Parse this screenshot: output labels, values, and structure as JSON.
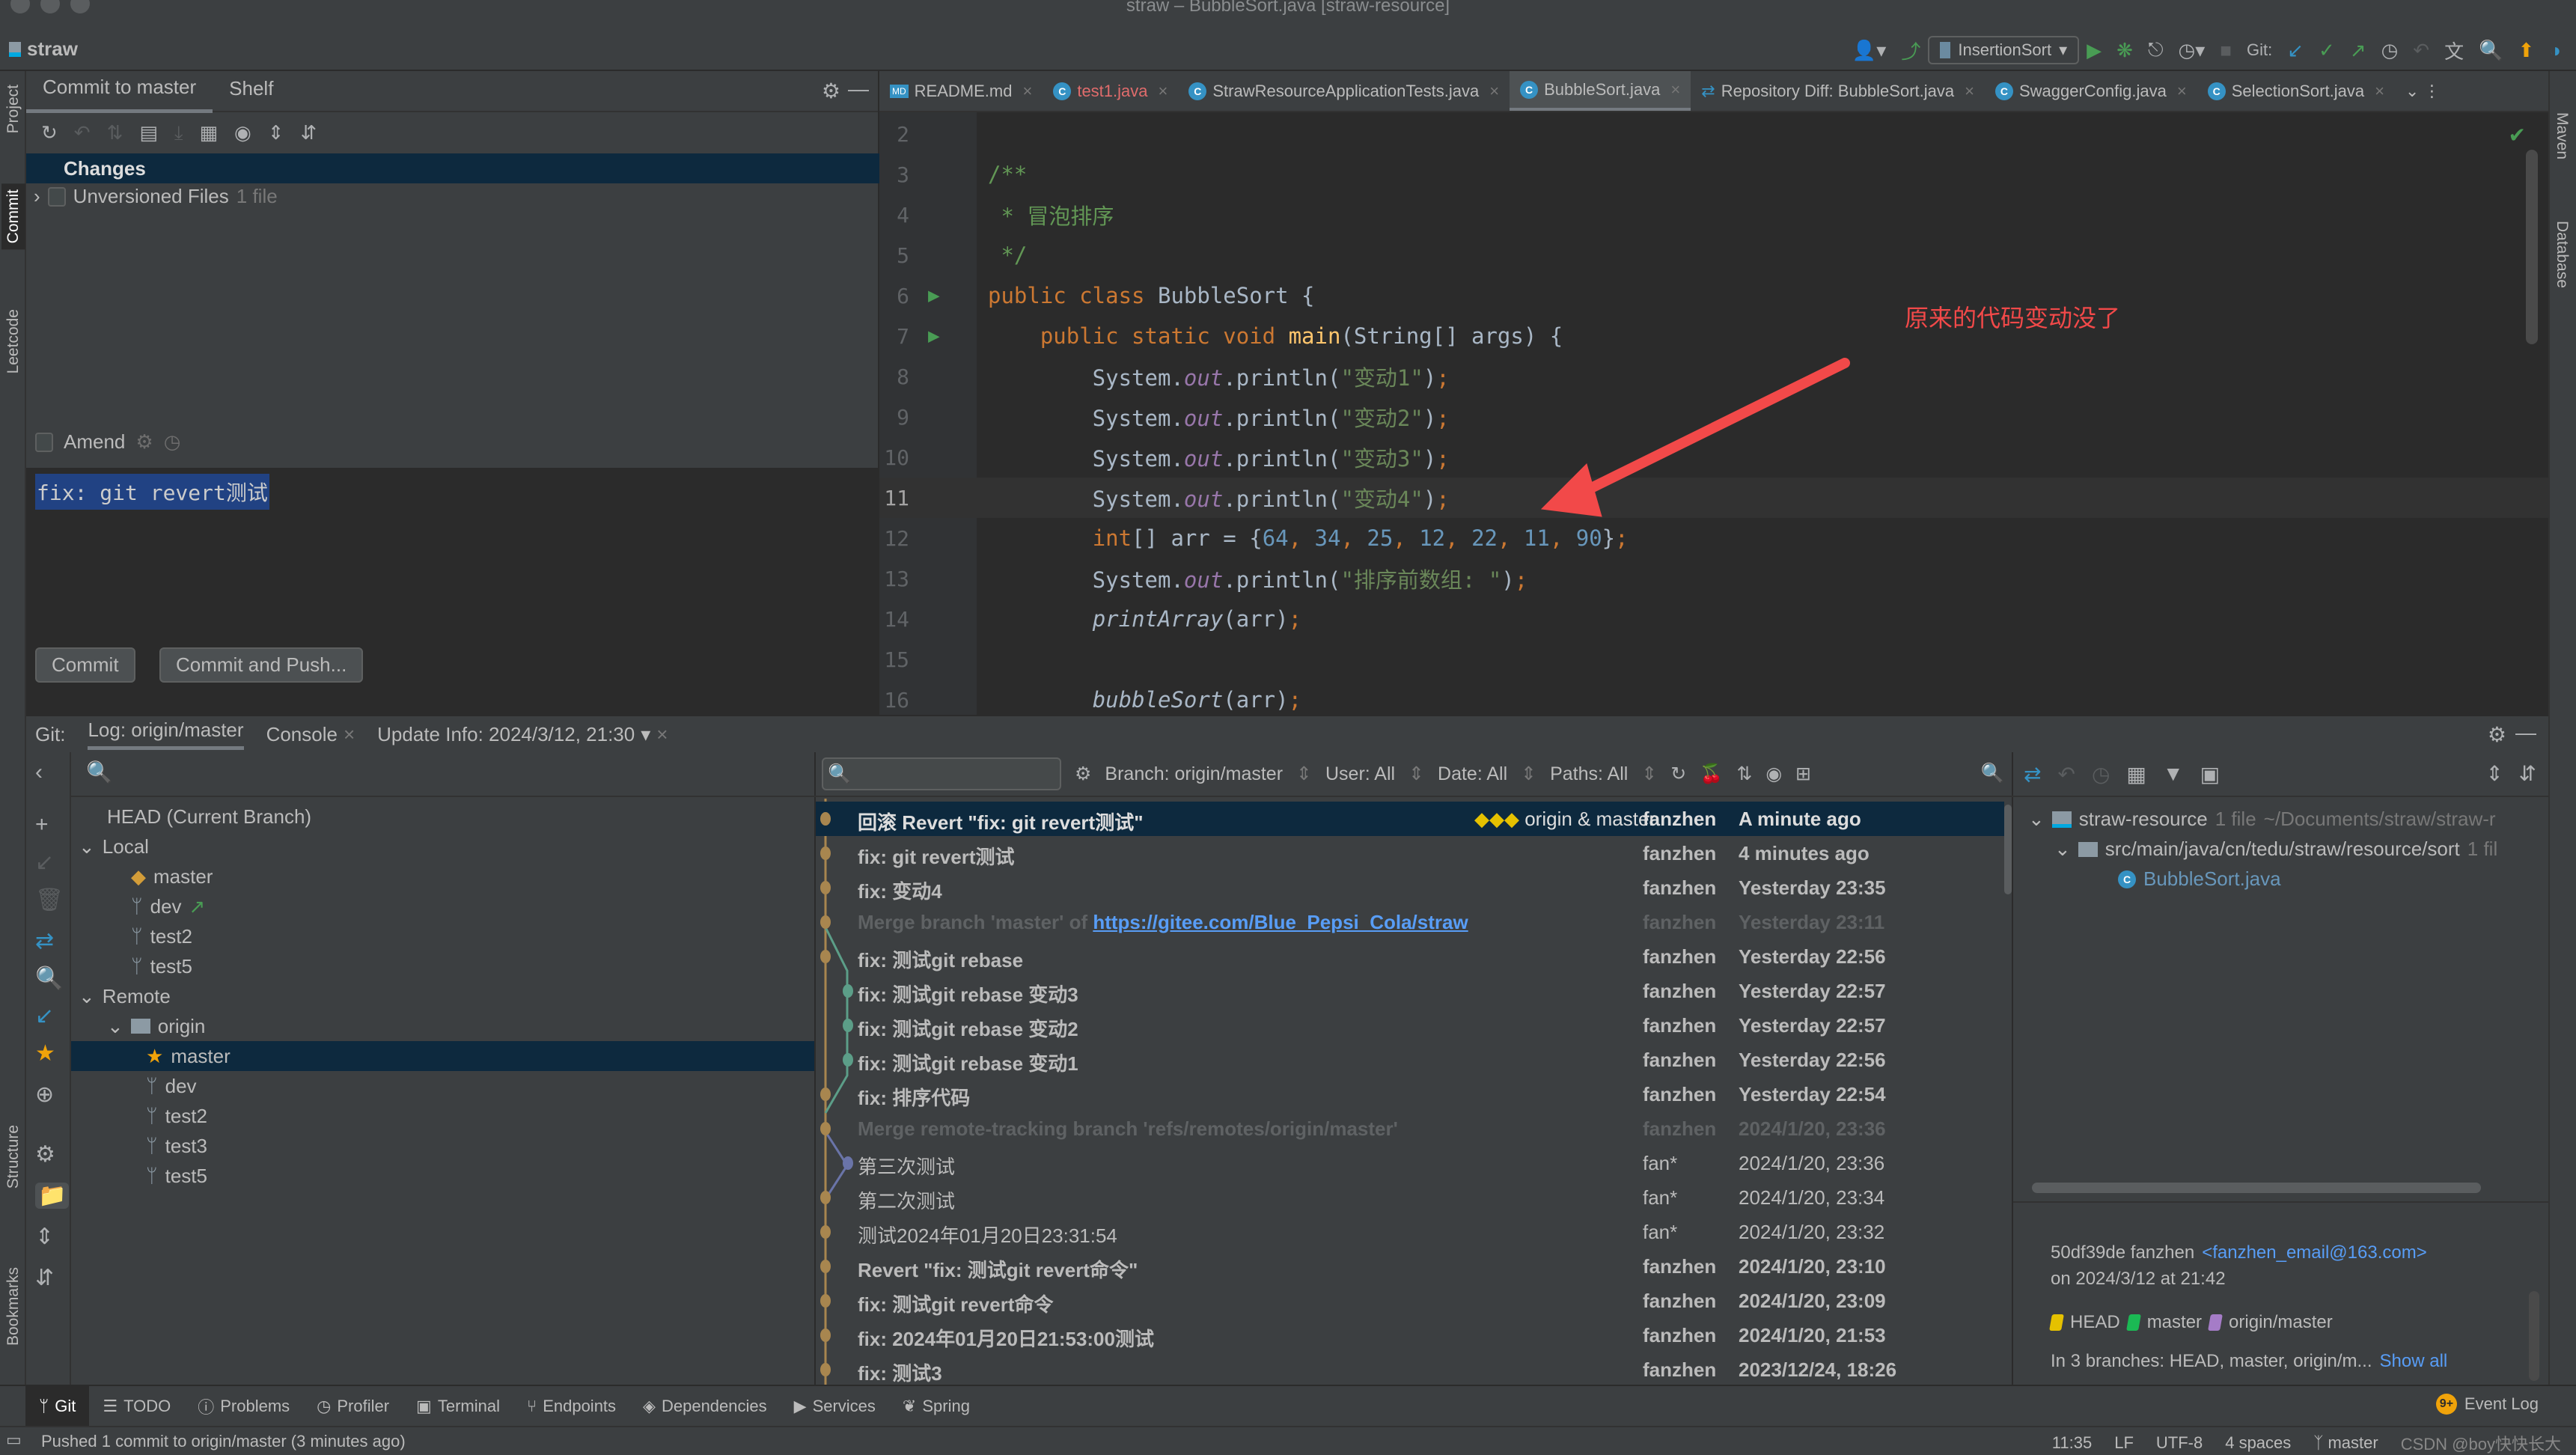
{
  "window": {
    "title": "straw – BubbleSort.java [straw-resource]",
    "project": "straw"
  },
  "toolbar": {
    "run_config": "InsertionSort",
    "git_label": "Git:",
    "icons": [
      "user-icon",
      "build-hammer-icon",
      "run-icon",
      "debug-icon",
      "coverage-icon",
      "profile-icon",
      "stop-icon",
      "git-update-icon",
      "git-commit-icon",
      "git-push-icon",
      "history-icon",
      "rollback-icon",
      "translate-icon",
      "search-icon",
      "update-icon",
      "plugin-icon"
    ]
  },
  "left_strip": {
    "tabs": [
      "Project",
      "Commit",
      "Leetcode",
      "Structure",
      "Bookmarks"
    ]
  },
  "right_strip": {
    "tabs": [
      "Maven",
      "Database"
    ]
  },
  "commit_panel": {
    "tabs": [
      "Commit to master",
      "Shelf"
    ],
    "changes_label": "Changes",
    "unversioned_label": "Unversioned Files",
    "unversioned_count": "1 file",
    "amend_label": "Amend",
    "message": "fix: git revert测试",
    "commit_button": "Commit",
    "commit_push_button": "Commit and Push..."
  },
  "editor": {
    "tabs": [
      {
        "label": "README.md",
        "type": "md"
      },
      {
        "label": "test1.java",
        "type": "java",
        "modified": true
      },
      {
        "label": "StrawResourceApplicationTests.java",
        "type": "java"
      },
      {
        "label": "BubbleSort.java",
        "type": "java",
        "active": true
      },
      {
        "label": "Repository Diff: BubbleSort.java",
        "type": "diff"
      },
      {
        "label": "SwaggerConfig.java",
        "type": "java"
      },
      {
        "label": "SelectionSort.java",
        "type": "java"
      }
    ],
    "current_line": 11,
    "lines": [
      {
        "n": "2",
        "html": ""
      },
      {
        "n": "3",
        "html": "<span class='cmt'>/**</span>"
      },
      {
        "n": "4",
        "html": "<span class='cmt'> * 冒泡排序</span>"
      },
      {
        "n": "5",
        "html": "<span class='cmt'> */</span>"
      },
      {
        "n": "6",
        "html": "<span class='kw'>public class </span>BubbleSort {",
        "run": true
      },
      {
        "n": "7",
        "html": "    <span class='kw'>public static void </span><span class='fn'>main</span>(String[] args) {",
        "run": true
      },
      {
        "n": "8",
        "html": "        System.<span class='fld'>out</span>.println(<span class='str'>\"变动1\"</span>)<span class='kw'>;</span>"
      },
      {
        "n": "9",
        "html": "        System.<span class='fld'>out</span>.println(<span class='str'>\"变动2\"</span>)<span class='kw'>;</span>"
      },
      {
        "n": "10",
        "html": "        System.<span class='fld'>out</span>.println(<span class='str'>\"变动3\"</span>)<span class='kw'>;</span>"
      },
      {
        "n": "11",
        "html": "        System.<span class='fld'>out</span>.println(<span class='str'>\"变动4\"</span>)<span class='kw'>;</span>"
      },
      {
        "n": "12",
        "html": "        <span class='kw'>int</span>[] arr = {<span class='num'>64</span><span class='kw'>, </span><span class='num'>34</span><span class='kw'>, </span><span class='num'>25</span><span class='kw'>, </span><span class='num'>12</span><span class='kw'>, </span><span class='num'>22</span><span class='kw'>, </span><span class='num'>11</span><span class='kw'>, </span><span class='num'>90</span>}<span class='kw'>;</span>"
      },
      {
        "n": "13",
        "html": "        System.<span class='fld'>out</span>.println(<span class='str'>\"排序前数组: \"</span>)<span class='kw'>;</span>"
      },
      {
        "n": "14",
        "html": "        <span class='it'>printArray</span>(arr)<span class='kw'>;</span>"
      },
      {
        "n": "15",
        "html": ""
      },
      {
        "n": "16",
        "html": "        <span class='it'>bubbleSort</span>(arr)<span class='kw'>;</span>"
      }
    ],
    "annotation": "原来的代码变动没了"
  },
  "git_panel": {
    "label": "Git:",
    "tabs": [
      {
        "label": "Log: origin/master",
        "active": true
      },
      {
        "label": "Console",
        "closable": true
      },
      {
        "label": "Update Info: 2024/3/12, 21:30",
        "closable": true,
        "dropdown": true
      }
    ],
    "branches": {
      "head": "HEAD (Current Branch)",
      "local_label": "Local",
      "local": [
        {
          "name": "master",
          "icon": "tag",
          "current": true
        },
        {
          "name": "dev",
          "outgoing": true
        },
        {
          "name": "test2"
        },
        {
          "name": "test5"
        }
      ],
      "remote_label": "Remote",
      "remote_name": "origin",
      "remote": [
        {
          "name": "master",
          "favorite": true,
          "selected": true
        },
        {
          "name": "dev"
        },
        {
          "name": "test2"
        },
        {
          "name": "test3"
        },
        {
          "name": "test5"
        }
      ]
    },
    "log_filters": {
      "branch": "Branch: origin/master",
      "user": "User: All",
      "date": "Date: All",
      "paths": "Paths: All"
    },
    "commits": [
      {
        "msg": "回滚 Revert \"fix: git revert测试\"",
        "refs": "origin & master",
        "author": "fanzhen",
        "date": "A minute ago",
        "selected": true,
        "lane": 0
      },
      {
        "msg": "fix: git revert测试",
        "author": "fanzhen",
        "date": "4 minutes ago",
        "lane": 0
      },
      {
        "msg": "fix: 变动4",
        "author": "fanzhen",
        "date": "Yesterday 23:35",
        "lane": 0
      },
      {
        "msg": "Merge branch 'master' of ",
        "link": "https://gitee.com/Blue_Pepsi_Cola/straw",
        "author": "fanzhen",
        "date": "Yesterday 23:11",
        "dim": true,
        "lane": 0
      },
      {
        "msg": "fix: 测试git rebase",
        "author": "fanzhen",
        "date": "Yesterday 22:56",
        "lane": 0
      },
      {
        "msg": "fix: 测试git rebase 变动3",
        "author": "fanzhen",
        "date": "Yesterday 22:57",
        "lane": 1
      },
      {
        "msg": "fix: 测试git rebase 变动2",
        "author": "fanzhen",
        "date": "Yesterday 22:57",
        "lane": 1
      },
      {
        "msg": "fix: 测试git rebase 变动1",
        "author": "fanzhen",
        "date": "Yesterday 22:56",
        "lane": 1
      },
      {
        "msg": "fix: 排序代码",
        "author": "fanzhen",
        "date": "Yesterday 22:54",
        "lane": 0
      },
      {
        "msg": "Merge remote-tracking branch 'refs/remotes/origin/master'",
        "author": "fanzhen",
        "date": "2024/1/20, 23:36",
        "dim": true,
        "lane": 0
      },
      {
        "msg": "第三次测试",
        "author": "fan*",
        "date": "2024/1/20, 23:36",
        "normal": true,
        "lane": 2
      },
      {
        "msg": "第二次测试",
        "author": "fan*",
        "date": "2024/1/20, 23:34",
        "normal": true,
        "lane": 0
      },
      {
        "msg": "测试2024年01月20日23:31:54",
        "author": "fan*",
        "date": "2024/1/20, 23:32",
        "normal": true,
        "lane": 0
      },
      {
        "msg": "Revert \"fix: 测试git revert命令\"",
        "author": "fanzhen",
        "date": "2024/1/20, 23:10",
        "lane": 0
      },
      {
        "msg": "fix: 测试git revert命令",
        "author": "fanzhen",
        "date": "2024/1/20, 23:09",
        "lane": 0
      },
      {
        "msg": "fix: 2024年01月20日21:53:00测试",
        "author": "fanzhen",
        "date": "2024/1/20, 21:53",
        "lane": 0
      },
      {
        "msg": "fix: 测试3",
        "author": "fanzhen",
        "date": "2023/12/24, 18:26",
        "lane": 0
      }
    ],
    "details": {
      "root": "straw-resource",
      "root_count": "1 file",
      "root_path": "~/Documents/straw/straw-r",
      "dir": "src/main/java/cn/tedu/straw/resource/sort",
      "dir_count": "1 fil",
      "file": "BubbleSort.java",
      "hash_author": "50df39de fanzhen",
      "email": "<fanzhen_email@163.com>",
      "on_date": "on 2024/3/12 at 21:42",
      "tags": [
        {
          "name": "HEAD",
          "color": "#e5c100"
        },
        {
          "name": "master",
          "color": "#1bb954"
        },
        {
          "name": "origin/master",
          "color": "#a57cc7"
        }
      ],
      "branches_text": "In 3 branches: HEAD, master, origin/m...",
      "show_all": "Show all"
    }
  },
  "tool_windows": [
    {
      "label": "Git",
      "icon": "git-branch-icon",
      "active": true
    },
    {
      "label": "TODO",
      "icon": "list-icon"
    },
    {
      "label": "Problems",
      "icon": "problems-icon"
    },
    {
      "label": "Profiler",
      "icon": "profiler-icon"
    },
    {
      "label": "Terminal",
      "icon": "terminal-icon"
    },
    {
      "label": "Endpoints",
      "icon": "endpoints-icon"
    },
    {
      "label": "Dependencies",
      "icon": "dependencies-icon"
    },
    {
      "label": "Services",
      "icon": "services-icon"
    },
    {
      "label": "Spring",
      "icon": "spring-icon"
    }
  ],
  "event_log": {
    "label": "Event Log",
    "badge": "9+"
  },
  "status": {
    "message": "Pushed 1 commit to origin/master (3 minutes ago)",
    "position": "11:35",
    "line_sep": "LF",
    "encoding": "UTF-8",
    "indent": "4 spaces",
    "branch": "master",
    "watermark": "CSDN @boy快快长大"
  }
}
